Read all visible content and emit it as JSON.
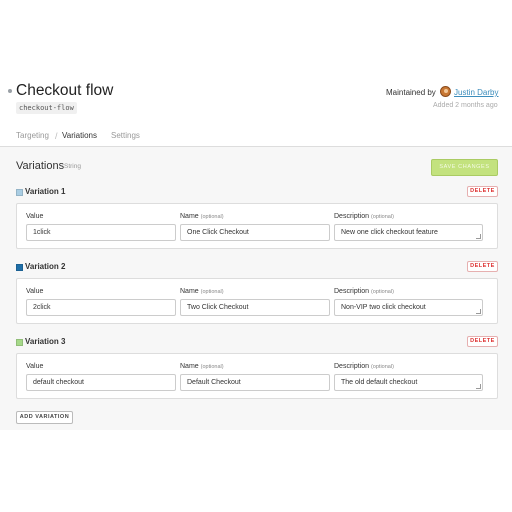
{
  "header": {
    "title": "Checkout flow",
    "key": "checkout-flow",
    "maintained_by_label": "Maintained by",
    "maintainer": "Justin Darby",
    "added": "Added 2 months ago"
  },
  "tabs": [
    {
      "label": "Targeting",
      "active": false
    },
    {
      "label": "Variations",
      "active": true
    },
    {
      "label": "Settings",
      "active": false
    }
  ],
  "variations_panel": {
    "title": "Variations",
    "type": "String",
    "save_label": "SAVE CHANGES",
    "delete_label": "DELETE",
    "add_label": "ADD VARIATION",
    "field_labels": {
      "value": "Value",
      "name": "Name",
      "description": "Description",
      "optional": "(optional)"
    },
    "items": [
      {
        "label": "Variation 1",
        "color": "#a9cde3",
        "value": "1click",
        "name": "One Click Checkout",
        "description": "New one click checkout feature"
      },
      {
        "label": "Variation 2",
        "color": "#1f6fa8",
        "value": "2click",
        "name": "Two Click Checkout",
        "description": "Non-VIP two click checkout"
      },
      {
        "label": "Variation 3",
        "color": "#a6d989",
        "value": "default checkout",
        "name": "Default Checkout",
        "description": "The old default checkout"
      }
    ]
  },
  "colors": {
    "link": "#3c8dbc",
    "save_button": "#c3e27e",
    "delete": "#dd3333"
  }
}
